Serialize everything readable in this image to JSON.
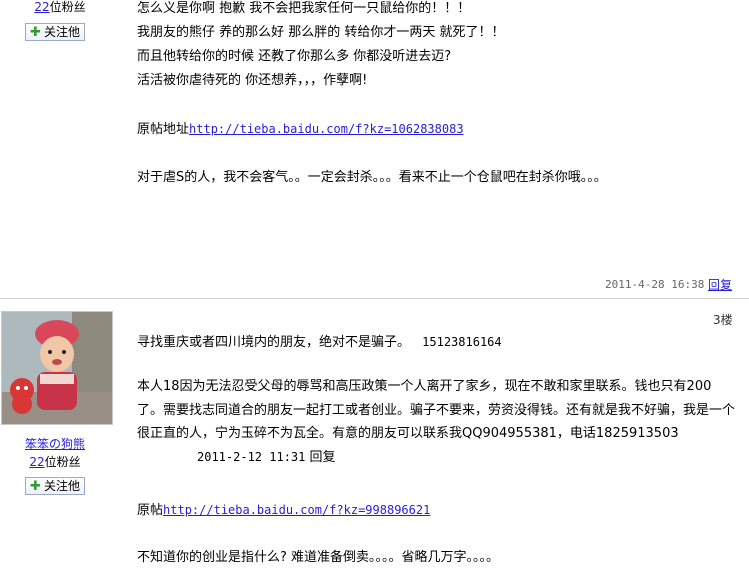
{
  "post1": {
    "fans_count": "22",
    "fans_suffix": "位粉丝",
    "follow_label": "关注他",
    "lines": [
      "怎么义是你啊 抱歉 我不会把我家任何一只鼠给你的！！！",
      "我朋友的熊仔 养的那么好 那么胖的 转给你才一两天 就死了！！",
      "而且他转给你的时候 还教了你那么多 你都没听进去迈?",
      "活活被你虐待死的 你还想养，，，作孽啊!"
    ],
    "source_label": "原帖地址",
    "source_url": "http://tieba.baidu.com/f?kz=1062838083",
    "closing": "对于虐S的人，我不会客气。。一定会封杀。。。看来不止一个仓鼠吧在封杀你哦。。。",
    "timestamp": "2011-4-28 16:38",
    "reply_label": "回复"
  },
  "post2": {
    "username": "笨笨の狗熊",
    "fans_count": "22",
    "fans_suffix": "位粉丝",
    "follow_label": "关注他",
    "floor": "3楼",
    "line1_text": "寻找重庆或者四川境内的朋友，绝对不是骗子。",
    "line1_phone": "15123816164",
    "paragraph": "本人18因为无法忍受父母的辱骂和高压政策一个人离开了家乡，现在不敢和家里联系。钱也只有200了。需要找志同道合的朋友一起打工或者创业。骗子不要来，劳资没得钱。还有就是我不好骗，我是一个很正直的人，宁为玉碎不为瓦全。有意的朋友可以联系我QQ904955381，电话1825913503",
    "quoted_date": "2011-2-12 11:31",
    "quoted_reply": "回复",
    "source_label": "原帖",
    "source_url": "http://tieba.baidu.com/f?kz=998896621",
    "closing": "不知道你的创业是指什么? 难道准备倒卖。。。。省略几万字。。。。"
  },
  "colors": {
    "link": "#261cdc",
    "divider": "#d4d4d4",
    "meta": "#666666",
    "follow_plus": "#2b9e2b"
  },
  "icons": {
    "follow": "plus-icon"
  }
}
